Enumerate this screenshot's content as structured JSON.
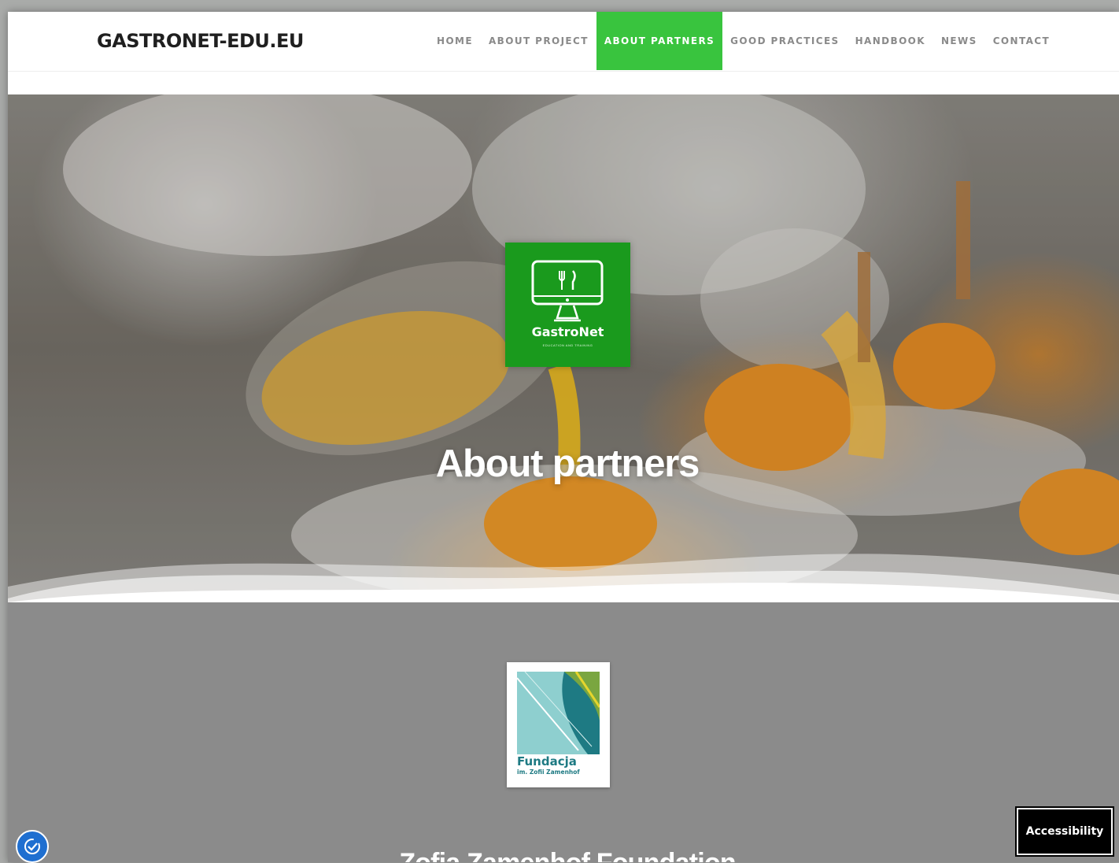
{
  "site": {
    "title": "GASTRONET-EDU.EU"
  },
  "nav": {
    "items": [
      {
        "label": "HOME",
        "active": false
      },
      {
        "label": "ABOUT PROJECT",
        "active": false
      },
      {
        "label": "ABOUT PARTNERS",
        "active": true
      },
      {
        "label": "GOOD PRACTICES",
        "active": false
      },
      {
        "label": "HANDBOOK",
        "active": false
      },
      {
        "label": "NEWS",
        "active": false
      },
      {
        "label": "CONTACT",
        "active": false
      }
    ],
    "active_color": "#39c43e"
  },
  "hero": {
    "logo_name": "GastroNet",
    "logo_tagline": "EDUCATION AND TRAINING",
    "logo_icon": "monitor-cutlery-icon",
    "title": "About partners"
  },
  "partner": {
    "logo_line1": "Fundacja",
    "logo_line2": "im. Zofii Zamenhof",
    "name": "Zofia Zamenhof Foundation"
  },
  "widgets": {
    "accessibility_label": "Accessibility",
    "accessibility_widget_icon": "accessibility-widget-icon"
  }
}
